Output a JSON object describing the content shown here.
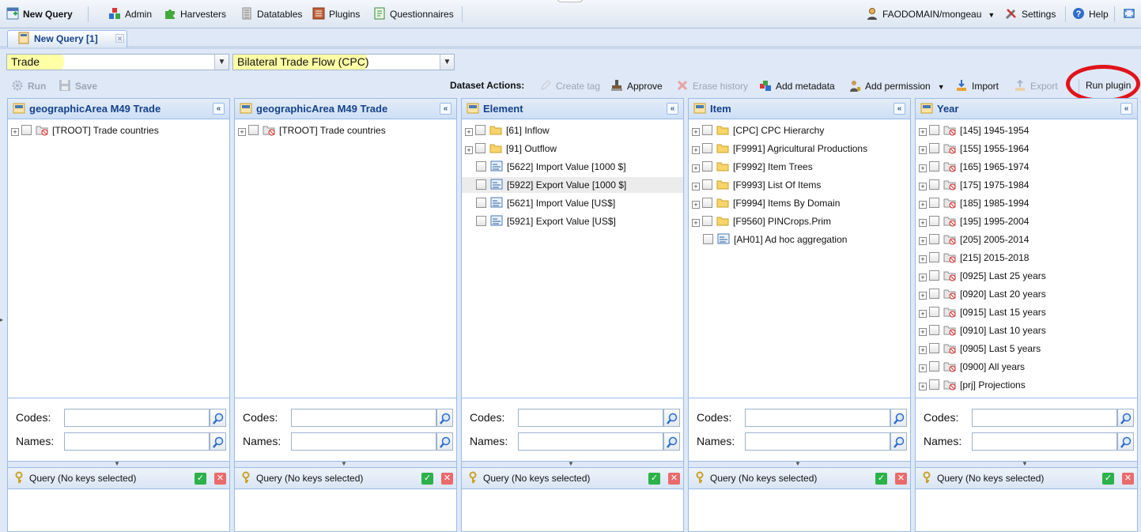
{
  "topbar": {
    "new_query": "New Query",
    "admin": "Admin",
    "harvesters": "Harvesters",
    "datatables": "Datatables",
    "plugins": "Plugins",
    "questionnaires": "Questionnaires",
    "user": "FAODOMAIN/mongeau",
    "settings": "Settings",
    "help": "Help"
  },
  "tab": {
    "label": "New Query [1]"
  },
  "selects": {
    "domain": "Trade",
    "dataset": "Bilateral Trade Flow (CPC)"
  },
  "actions": {
    "run": "Run",
    "save": "Save",
    "dataset_actions": "Dataset Actions:",
    "create_tag": "Create tag",
    "approve": "Approve",
    "erase_history": "Erase history",
    "add_metadata": "Add metadata",
    "add_permission": "Add permission",
    "import": "Import",
    "export": "Export",
    "run_plugin": "Run plugin"
  },
  "search": {
    "codes_label": "Codes:",
    "names_label": "Names:"
  },
  "query_status": "Query (No keys selected)",
  "panels": [
    {
      "title": "geographicArea M49 Trade",
      "nodes": [
        {
          "label": "[TROOT] Trade countries",
          "kind": "excl",
          "expand": true
        }
      ]
    },
    {
      "title": "geographicArea M49 Trade",
      "nodes": [
        {
          "label": "[TROOT] Trade countries",
          "kind": "excl",
          "expand": true
        }
      ]
    },
    {
      "title": "Element",
      "nodes": [
        {
          "label": "[61] Inflow",
          "kind": "folder",
          "expand": true
        },
        {
          "label": "[91] Outflow",
          "kind": "folder",
          "expand": true
        },
        {
          "label": "[5622] Import Value [1000 $]",
          "kind": "leaf",
          "expand": false
        },
        {
          "label": "[5922] Export Value [1000 $]",
          "kind": "leaf",
          "expand": false,
          "selected": true
        },
        {
          "label": "[5621] Import Value [US$]",
          "kind": "leaf",
          "expand": false
        },
        {
          "label": "[5921] Export Value [US$]",
          "kind": "leaf",
          "expand": false
        }
      ]
    },
    {
      "title": "Item",
      "nodes": [
        {
          "label": "[CPC] CPC Hierarchy",
          "kind": "folder",
          "expand": true
        },
        {
          "label": "[F9991] Agricultural Productions",
          "kind": "folder",
          "expand": true
        },
        {
          "label": "[F9992] Item Trees",
          "kind": "folder",
          "expand": true
        },
        {
          "label": "[F9993] List Of Items",
          "kind": "folder",
          "expand": true
        },
        {
          "label": "[F9994] Items By Domain",
          "kind": "folder",
          "expand": true
        },
        {
          "label": "[F9560] PINCrops.Prim",
          "kind": "folder",
          "expand": true
        },
        {
          "label": "[AH01] Ad hoc aggregation",
          "kind": "leaf",
          "expand": false
        }
      ]
    },
    {
      "title": "Year",
      "nodes": [
        {
          "label": "[145] 1945-1954",
          "kind": "excl",
          "expand": true
        },
        {
          "label": "[155] 1955-1964",
          "kind": "excl",
          "expand": true
        },
        {
          "label": "[165] 1965-1974",
          "kind": "excl",
          "expand": true
        },
        {
          "label": "[175] 1975-1984",
          "kind": "excl",
          "expand": true
        },
        {
          "label": "[185] 1985-1994",
          "kind": "excl",
          "expand": true
        },
        {
          "label": "[195] 1995-2004",
          "kind": "excl",
          "expand": true
        },
        {
          "label": "[205] 2005-2014",
          "kind": "excl",
          "expand": true
        },
        {
          "label": "[215] 2015-2018",
          "kind": "excl",
          "expand": true
        },
        {
          "label": "[0925] Last 25 years",
          "kind": "excl",
          "expand": true
        },
        {
          "label": "[0920] Last 20 years",
          "kind": "excl",
          "expand": true
        },
        {
          "label": "[0915] Last 15 years",
          "kind": "excl",
          "expand": true
        },
        {
          "label": "[0910] Last 10 years",
          "kind": "excl",
          "expand": true
        },
        {
          "label": "[0905] Last 5 years",
          "kind": "excl",
          "expand": true
        },
        {
          "label": "[0900] All years",
          "kind": "excl",
          "expand": true
        },
        {
          "label": "[prj] Projections",
          "kind": "excl",
          "expand": true
        }
      ]
    }
  ]
}
